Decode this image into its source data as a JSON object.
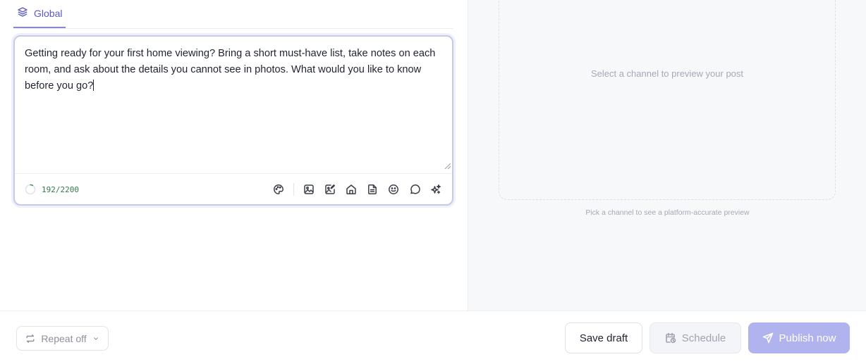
{
  "composer": {
    "tab_label": "Global",
    "text": "Getting ready for your first home viewing? Bring a short must-have list, take notes on each room, and ask about the details you cannot see in photos. What would you like to know before you go?",
    "char_count": "192/2200",
    "char_progress": 0.087
  },
  "toolbar": {
    "icons": [
      "palette-icon",
      "image-icon",
      "image-edit-icon",
      "home-icon",
      "document-icon",
      "emoji-icon",
      "comment-icon",
      "sparkles-icon"
    ]
  },
  "preview": {
    "empty_message": "Select a channel to preview your post",
    "hint": "Pick a channel to see a platform-accurate preview"
  },
  "actions": {
    "repeat_label": "Repeat off",
    "save_draft_label": "Save draft",
    "schedule_label": "Schedule",
    "publish_label": "Publish now"
  },
  "colors": {
    "accent": "#5b57c9",
    "publish_bg": "#b1b3ee",
    "counter": "#2f7a4a"
  }
}
